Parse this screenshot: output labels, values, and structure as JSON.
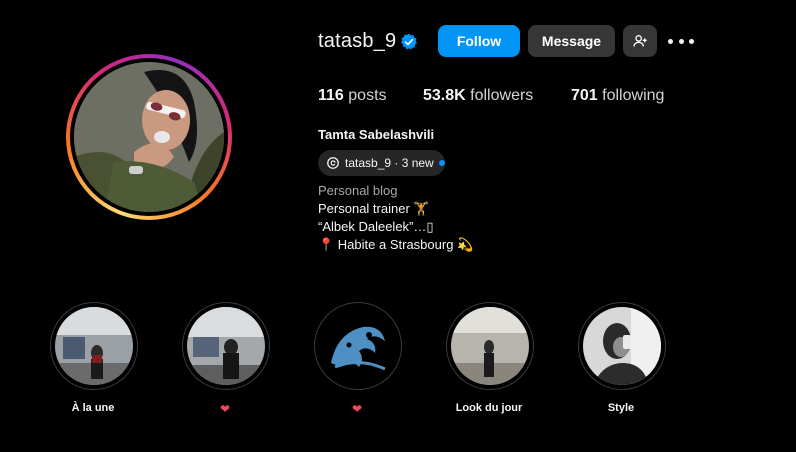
{
  "profile": {
    "username": "tatasb_9",
    "full_name": "Tamta Sabelashvili",
    "threads_badge": "tatasb_9 · 3 new",
    "category": "Personal blog",
    "bio": [
      "Personal trainer 🏋",
      "“Albek Daleelek”…▯",
      "📍 Habite a Strasbourg 💫"
    ]
  },
  "actions": {
    "follow_label": "Follow",
    "message_label": "Message",
    "add_user_icon": "person-plus-icon",
    "more_icon": "more-horizontal-icon"
  },
  "stats": {
    "posts_count": "116",
    "posts_label": "posts",
    "followers_count": "53.8K",
    "followers_label": "followers",
    "following_count": "701",
    "following_label": "following"
  },
  "highlights": [
    {
      "label": "À la une"
    },
    {
      "label": "❤"
    },
    {
      "label": "❤"
    },
    {
      "label": "Look du jour"
    },
    {
      "label": "Style"
    }
  ],
  "colors": {
    "accent": "#0095f6",
    "button_secondary": "#363636",
    "verified": "#0095f6",
    "heart": "#ed4956"
  }
}
